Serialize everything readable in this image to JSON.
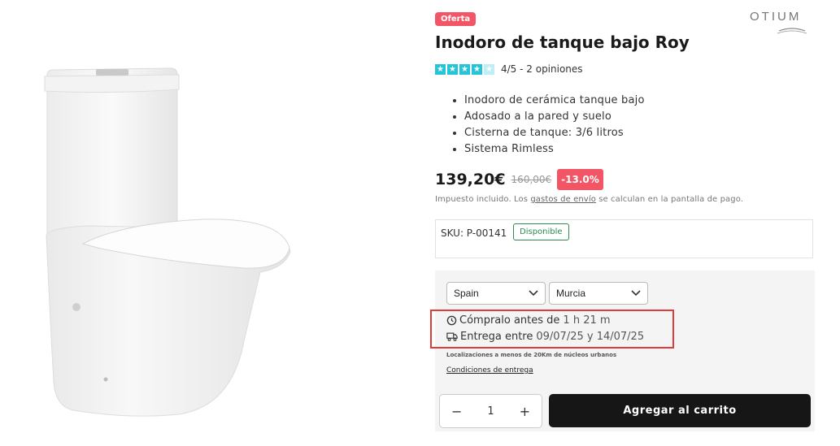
{
  "badge": "Oferta",
  "brand": "OTIUM",
  "title": "Inodoro de tanque bajo Roy",
  "rating": {
    "value": 4,
    "max": 5,
    "text": "4/5 - 2 opiniones"
  },
  "features": [
    "Inodoro de cerámica tanque bajo",
    "Adosado a la pared y suelo",
    "Cisterna de tanque: 3/6 litros",
    "Sistema Rimless"
  ],
  "price": {
    "current": "139,20€",
    "old": "160,00€",
    "discount": "-13.0%"
  },
  "tax_note": {
    "before": "Impuesto incluido. Los ",
    "link": "gastos de envío",
    "after": " se calculan en la pantalla de pago."
  },
  "sku": {
    "label": "SKU: P-00141",
    "stock": "Disponible"
  },
  "shipping": {
    "country": "Spain",
    "region": "Murcia",
    "buy_before_label": "Cómpralo antes de",
    "buy_before_value": "1 h 21 m",
    "delivery_label": "Entrega entre",
    "delivery_value": "09/07/25 y 14/07/25",
    "note": "Localizaciones a menos de 20Km de núcleos urbanos",
    "conditions": "Condiciones de entrega"
  },
  "quantity": {
    "minus": "−",
    "value": "1",
    "plus": "+"
  },
  "cart_button": "Agregar al carrito",
  "colors": {
    "accent": "#25c4d8",
    "sale": "#f25565",
    "stock": "#2e8a4f",
    "button": "#161616"
  }
}
